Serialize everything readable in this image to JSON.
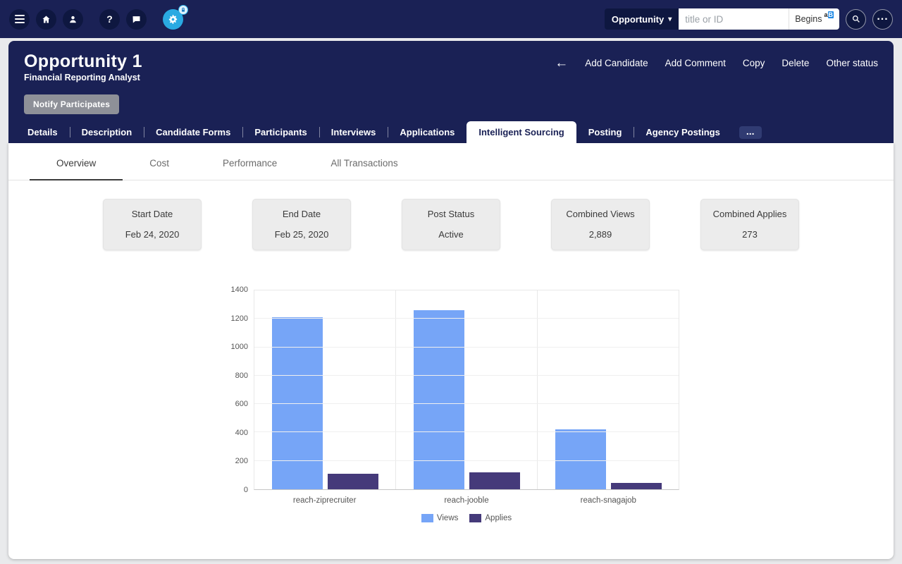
{
  "theme": {
    "navy": "#1a2155",
    "icon_circle": "#0e1740",
    "gear_blue": "#2aaae2",
    "card_bg": "#ececec",
    "views_color": "#76a5f7",
    "applies_color": "#453a7a"
  },
  "topbar": {
    "icons": [
      "menu-icon",
      "home-icon",
      "user-icon",
      "help-icon",
      "chat-icon",
      "settings-icon",
      "lock-badge-icon",
      "search-icon",
      "more-icon",
      "match-case-icon",
      "caret-down-icon"
    ],
    "help_glyph": "?",
    "entity_selector": "Opportunity",
    "search_placeholder": "title or ID",
    "begins_label": "Begins",
    "more_glyph": "..."
  },
  "header": {
    "title": "Opportunity 1",
    "subtitle": "Financial Reporting Analyst",
    "back_glyph": "←",
    "actions": [
      "Add Candidate",
      "Add Comment",
      "Copy",
      "Delete",
      "Other status"
    ],
    "notify_button": "Notify Participates"
  },
  "tabs": [
    "Details",
    "Description",
    "Candidate Forms",
    "Participants",
    "Interviews",
    "Applications",
    "Intelligent Sourcing",
    "Posting",
    "Agency Postings"
  ],
  "tabs_more": "...",
  "active_tab": "Intelligent Sourcing",
  "subtabs": [
    "Overview",
    "Cost",
    "Performance",
    "All Transactions"
  ],
  "active_subtab": "Overview",
  "cards": [
    {
      "label": "Start Date",
      "value": "Feb 24, 2020"
    },
    {
      "label": "End Date",
      "value": "Feb 25, 2020"
    },
    {
      "label": "Post Status",
      "value": "Active"
    },
    {
      "label": "Combined Views",
      "value": "2,889"
    },
    {
      "label": "Combined Applies",
      "value": "273"
    }
  ],
  "chart_data": {
    "type": "bar",
    "categories": [
      "reach-ziprecruiter",
      "reach-jooble",
      "reach-snagajob"
    ],
    "series": [
      {
        "name": "Views",
        "color": "#76a5f7",
        "values": [
          1210,
          1259,
          420
        ]
      },
      {
        "name": "Applies",
        "color": "#453a7a",
        "values": [
          110,
          120,
          43
        ]
      }
    ],
    "title": "",
    "xlabel": "",
    "ylabel": "",
    "ylim": [
      0,
      1400
    ],
    "ytick_step": 200,
    "grid": true,
    "legend_position": "bottom"
  }
}
